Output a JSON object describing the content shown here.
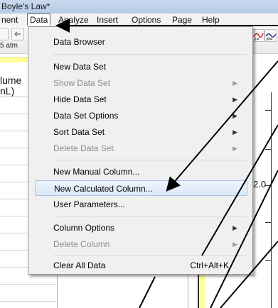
{
  "window": {
    "title": "Boyle's Law*"
  },
  "menubar": {
    "items": [
      "nent",
      "Data",
      "Analyze",
      "Insert",
      "Options",
      "Page",
      "Help"
    ],
    "active": "Data"
  },
  "toolbar": {
    "pressure_value": "5 atm"
  },
  "table": {
    "column_header_line1": "lume",
    "column_header_line2": "nL)"
  },
  "graph": {
    "y_tick_label": "2.0"
  },
  "data_menu": {
    "items": [
      {
        "label": "Data Browser",
        "enabled": true,
        "submenu": false
      },
      {
        "label": "New Data Set",
        "enabled": true,
        "submenu": false
      },
      {
        "label": "Show Data Set",
        "enabled": false,
        "submenu": true
      },
      {
        "label": "Hide Data Set",
        "enabled": true,
        "submenu": true
      },
      {
        "label": "Data Set Options",
        "enabled": true,
        "submenu": true
      },
      {
        "label": "Sort Data Set",
        "enabled": true,
        "submenu": true
      },
      {
        "label": "Delete Data Set",
        "enabled": false,
        "submenu": true
      },
      {
        "label": "New Manual Column...",
        "enabled": true,
        "submenu": false
      },
      {
        "label": "New Calculated Column...",
        "enabled": true,
        "submenu": false,
        "highlighted": true
      },
      {
        "label": "User Parameters...",
        "enabled": true,
        "submenu": false
      },
      {
        "label": "Column Options",
        "enabled": true,
        "submenu": true
      },
      {
        "label": "Delete Column",
        "enabled": false,
        "submenu": true
      },
      {
        "label": "Clear All Data",
        "enabled": true,
        "submenu": false,
        "shortcut": "Ctrl+Alt+K"
      }
    ]
  },
  "colors": {
    "highlight": "#dce8f8",
    "yellow": "#ffff99",
    "disabled_text": "#8d8d8d"
  }
}
